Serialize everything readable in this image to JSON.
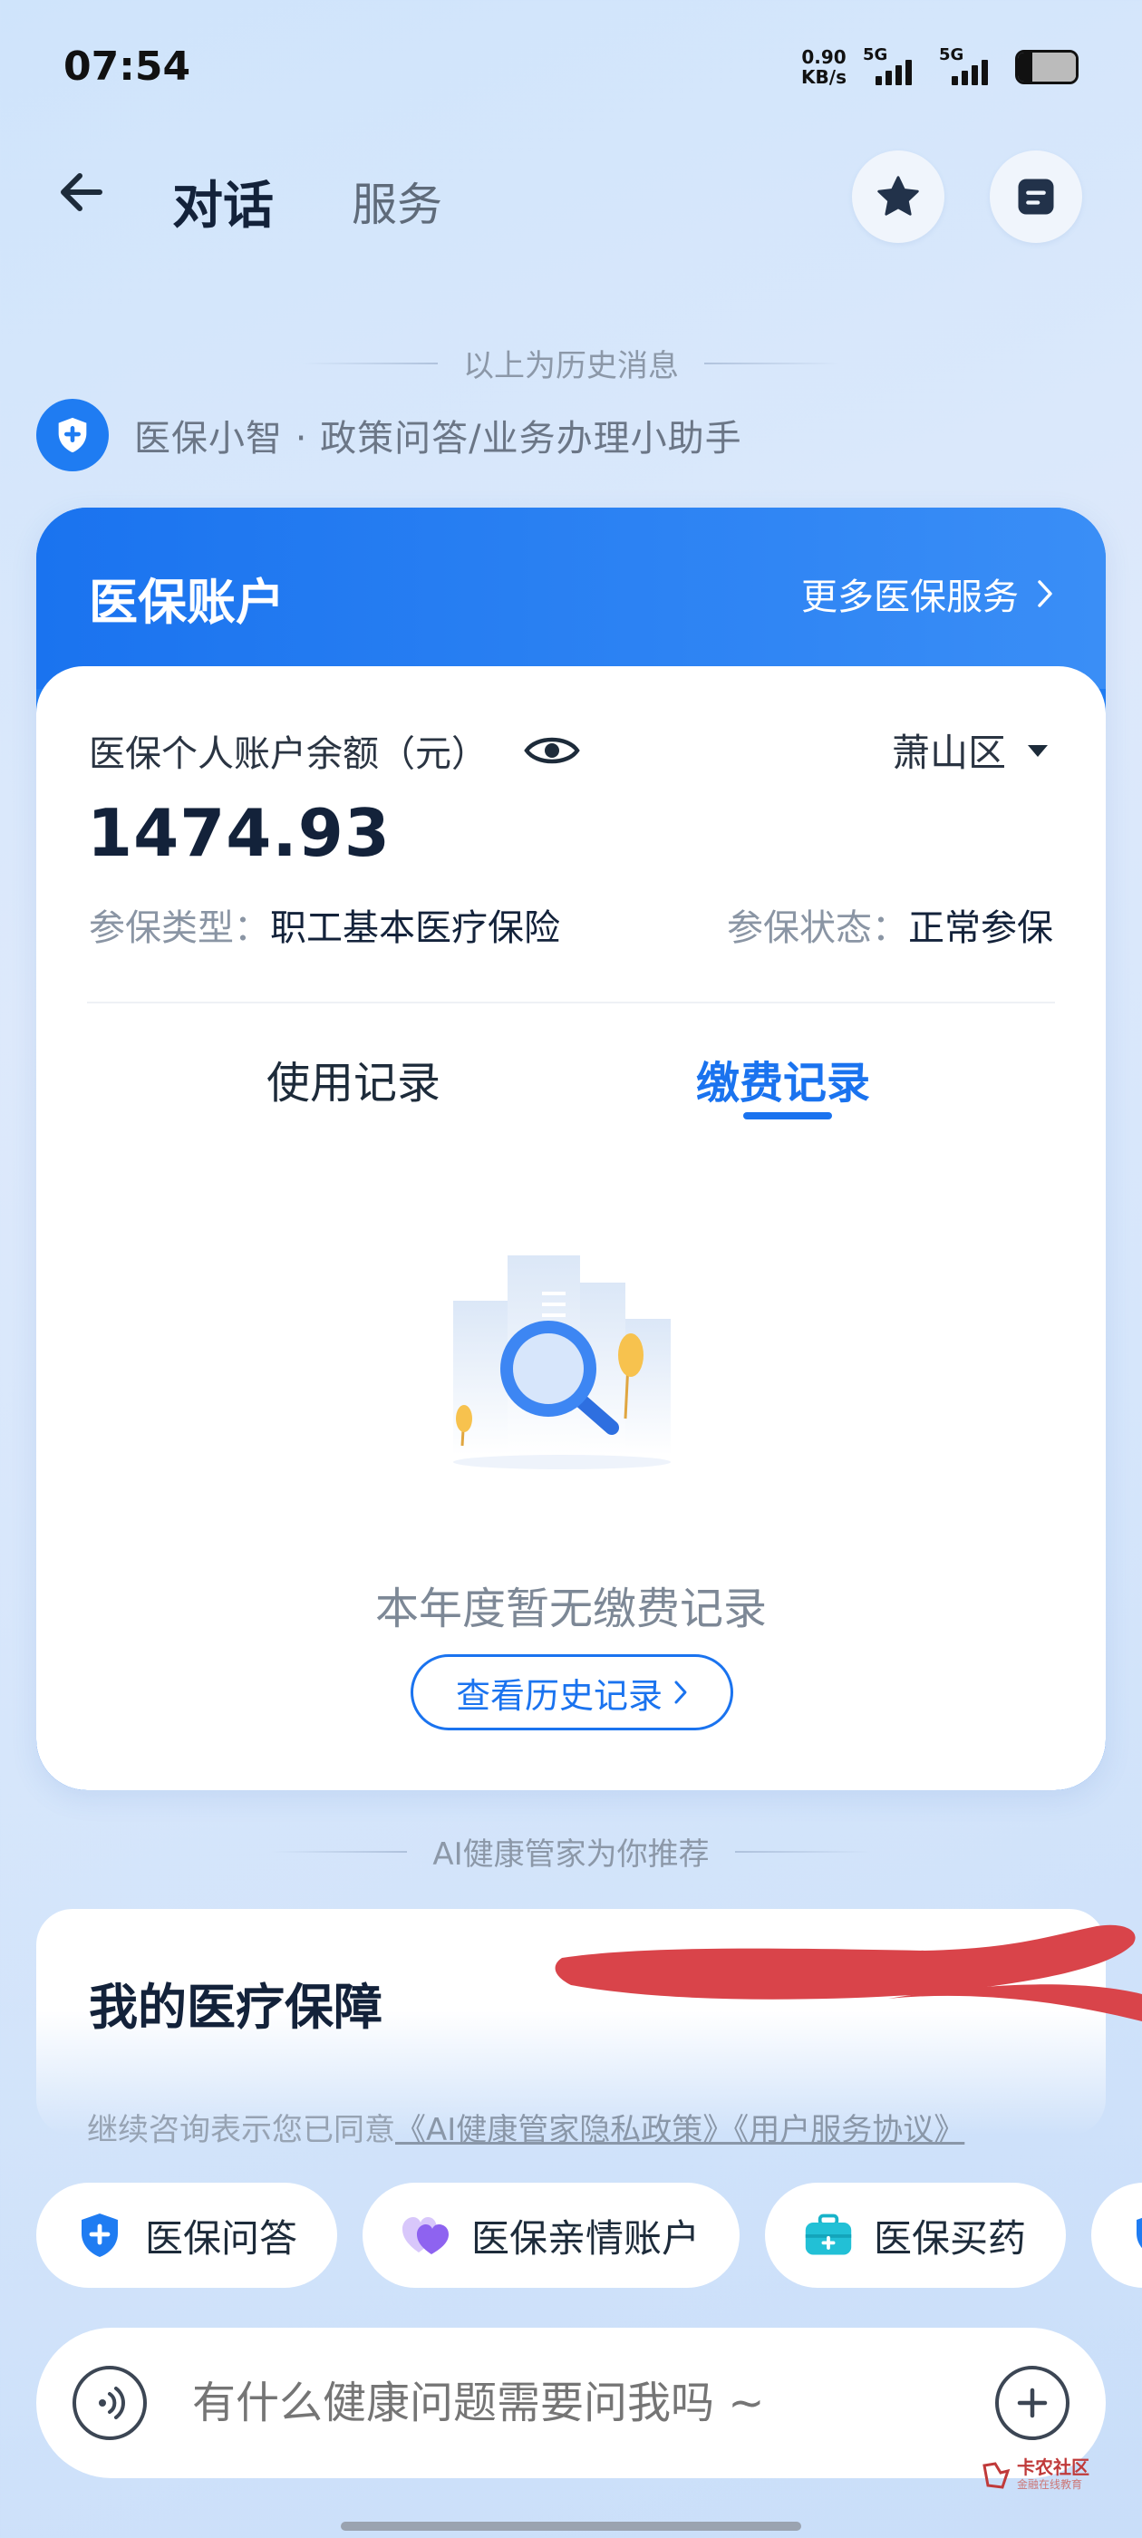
{
  "status_bar": {
    "time": "07:54",
    "net_speed_value": "0.90",
    "net_speed_unit": "KB/s",
    "sim1_label": "5G",
    "sim2_label": "5G",
    "battery_level": 0.25
  },
  "header": {
    "tab_dialog": "对话",
    "tab_service": "服务"
  },
  "history_divider": "以上为历史消息",
  "assistant_intro": "医保小智 · 政策问答/业务办理小助手",
  "account_card": {
    "title": "医保账户",
    "more_services": "更多医保服务",
    "balance_label": "医保个人账户余额（元）",
    "region": "萧山区",
    "balance": "1474.93",
    "insurance_type_key": "参保类型：",
    "insurance_type_value": "职工基本医疗保险",
    "insurance_status_key": "参保状态：",
    "insurance_status_value": "正常参保",
    "tabs": [
      "使用记录",
      "缴费记录"
    ],
    "selected_tab": "缴费记录",
    "empty_text": "本年度暂无缴费记录",
    "history_button": "查看历史记录"
  },
  "recommend_divider": "AI健康管家为你推荐",
  "recommend_card": {
    "title": "我的医疗保障"
  },
  "consent": {
    "prefix": "继续咨询表示您已同意",
    "links": "《AI健康管家隐私政策》《用户服务协议》"
  },
  "quick_chips": [
    {
      "label": "医保问答",
      "icon": "shield-plus-icon"
    },
    {
      "label": "医保亲情账户",
      "icon": "hearts-icon"
    },
    {
      "label": "医保买药",
      "icon": "medkit-icon"
    }
  ],
  "input": {
    "placeholder": "有什么健康问题需要问我吗 ~"
  },
  "watermark": {
    "line1": "卡农社区",
    "line2": "金融在线教育"
  },
  "colors": {
    "accent": "#1a73ef",
    "redaction": "#d9444a"
  }
}
